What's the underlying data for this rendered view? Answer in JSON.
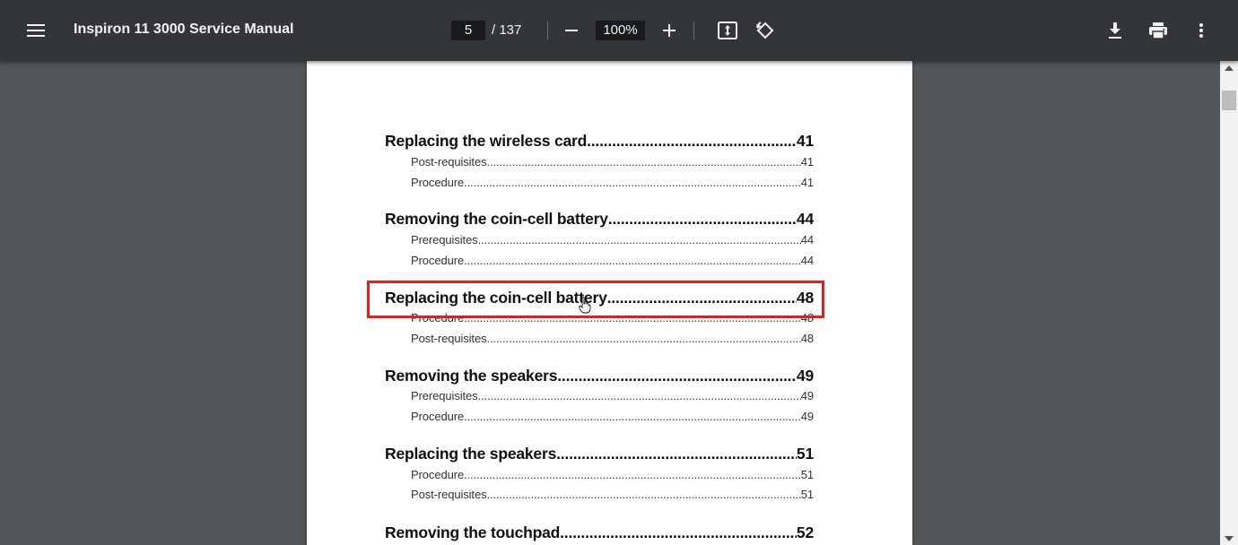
{
  "toolbar": {
    "title": "Inspiron 11 3000 Service Manual",
    "current_page": "5",
    "page_total": "/ 137",
    "zoom": "100%",
    "icons": {
      "menu": "menu-icon",
      "zoom_out": "minus-icon",
      "zoom_in": "plus-icon",
      "fit": "fit-page-icon",
      "rotate": "rotate-icon",
      "download": "download-icon",
      "print": "print-icon",
      "more": "more-vert-icon"
    }
  },
  "toc": [
    {
      "title": "Replacing the wireless card",
      "page": "41",
      "subs": [
        {
          "title": "Post-requisites",
          "page": "41"
        },
        {
          "title": "Procedure",
          "page": "41"
        }
      ]
    },
    {
      "title": "Removing the coin-cell battery",
      "page": "44",
      "subs": [
        {
          "title": "Prerequisites",
          "page": "44"
        },
        {
          "title": "Procedure",
          "page": "44"
        }
      ]
    },
    {
      "title": "Replacing the coin-cell battery",
      "page": "48",
      "subs": [
        {
          "title": "Procedure",
          "page": "48"
        },
        {
          "title": "Post-requisites",
          "page": "48"
        }
      ]
    },
    {
      "title": "Removing the speakers",
      "page": "49",
      "subs": [
        {
          "title": "Prerequisites",
          "page": "49"
        },
        {
          "title": "Procedure",
          "page": "49"
        }
      ]
    },
    {
      "title": "Replacing the speakers",
      "page": "51",
      "subs": [
        {
          "title": "Procedure",
          "page": "51"
        },
        {
          "title": "Post-requisites",
          "page": "51"
        }
      ]
    },
    {
      "title": "Removing the touchpad",
      "page": "52",
      "subs": []
    }
  ],
  "colors": {
    "toolbar_bg": "#323639",
    "viewer_bg": "#525659",
    "highlight": "#e0201f"
  }
}
